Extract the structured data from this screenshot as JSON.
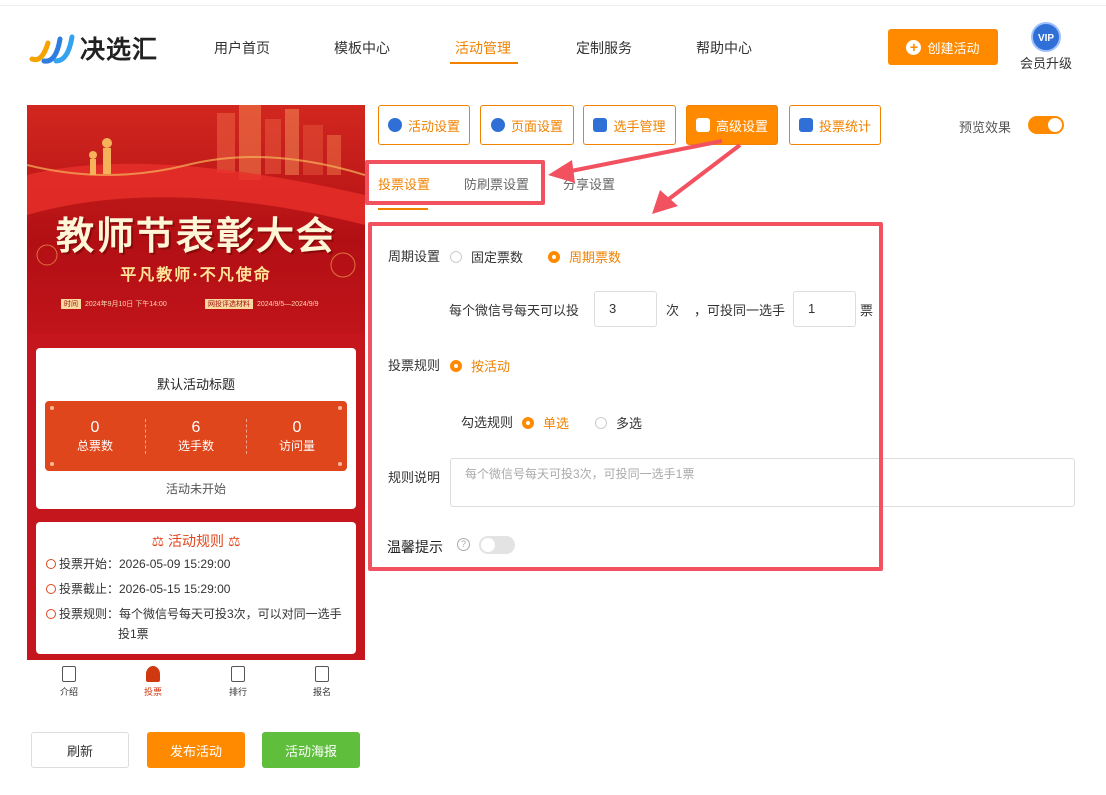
{
  "brand": {
    "name": "决选汇"
  },
  "nav": [
    {
      "label": "用户首页",
      "active": false
    },
    {
      "label": "模板中心",
      "active": false
    },
    {
      "label": "活动管理",
      "active": true
    },
    {
      "label": "定制服务",
      "active": false
    },
    {
      "label": "帮助中心",
      "active": false
    }
  ],
  "header": {
    "create_label": "创建活动",
    "vip_badge": "VIP",
    "vip_label": "会员升级"
  },
  "preview": {
    "banner_title": "教师节表彰大会",
    "banner_subtitle": "平凡教师·不凡使命",
    "banner_time_tag": "时间",
    "banner_time": "2024年9月10日 下午14:00",
    "banner_review_tag": "网投评选材料",
    "banner_review": "2024/9/5—2024/9/9",
    "activity_title": "默认活动标题",
    "stats": [
      {
        "value": "0",
        "label": "总票数"
      },
      {
        "value": "6",
        "label": "选手数"
      },
      {
        "value": "0",
        "label": "访问量"
      }
    ],
    "status": "活动未开始",
    "rules_title": "活动规则",
    "rules": {
      "start": "投票开始：2026-05-09 15:29:00",
      "end": "投票截止：2026-05-15 15:29:00",
      "rule_line1": "投票规则：每个微信号每天可投3次，可以对同一选手",
      "rule_line2": "投1票"
    },
    "tabbar": [
      {
        "label": "介绍",
        "active": false
      },
      {
        "label": "投票",
        "active": true
      },
      {
        "label": "排行",
        "active": false
      },
      {
        "label": "报名",
        "active": false
      }
    ]
  },
  "bottom_buttons": {
    "refresh": "刷新",
    "publish": "发布活动",
    "poster": "活动海报"
  },
  "setting_tabs": [
    {
      "label": "活动设置",
      "active": false
    },
    {
      "label": "页面设置",
      "active": false
    },
    {
      "label": "选手管理",
      "active": false
    },
    {
      "label": "高级设置",
      "active": true
    },
    {
      "label": "投票统计",
      "active": false
    }
  ],
  "preview_toggle": {
    "label": "预览效果",
    "on": true
  },
  "sub_tabs": [
    {
      "label": "投票设置",
      "active": true
    },
    {
      "label": "防刷票设置",
      "active": false
    },
    {
      "label": "分享设置",
      "active": false
    }
  ],
  "form": {
    "cycle_label": "周期设置",
    "cycle_options": [
      "固定票数",
      "周期票数"
    ],
    "cycle_selected": "周期票数",
    "daily_prefix": "每个微信号每天可以投",
    "daily_count": "3",
    "daily_unit": "次",
    "same_prefix": "，可投同一选手",
    "same_count": "1",
    "same_unit": "票",
    "rule_label": "投票规则",
    "rule_option": "按活动",
    "check_label": "勾选规则",
    "check_options": [
      "单选",
      "多选"
    ],
    "check_selected": "单选",
    "desc_label": "规则说明",
    "desc_placeholder": "每个微信号每天可投3次，可投同一选手1票",
    "tip_label": "温馨提示",
    "tip_on": false
  }
}
